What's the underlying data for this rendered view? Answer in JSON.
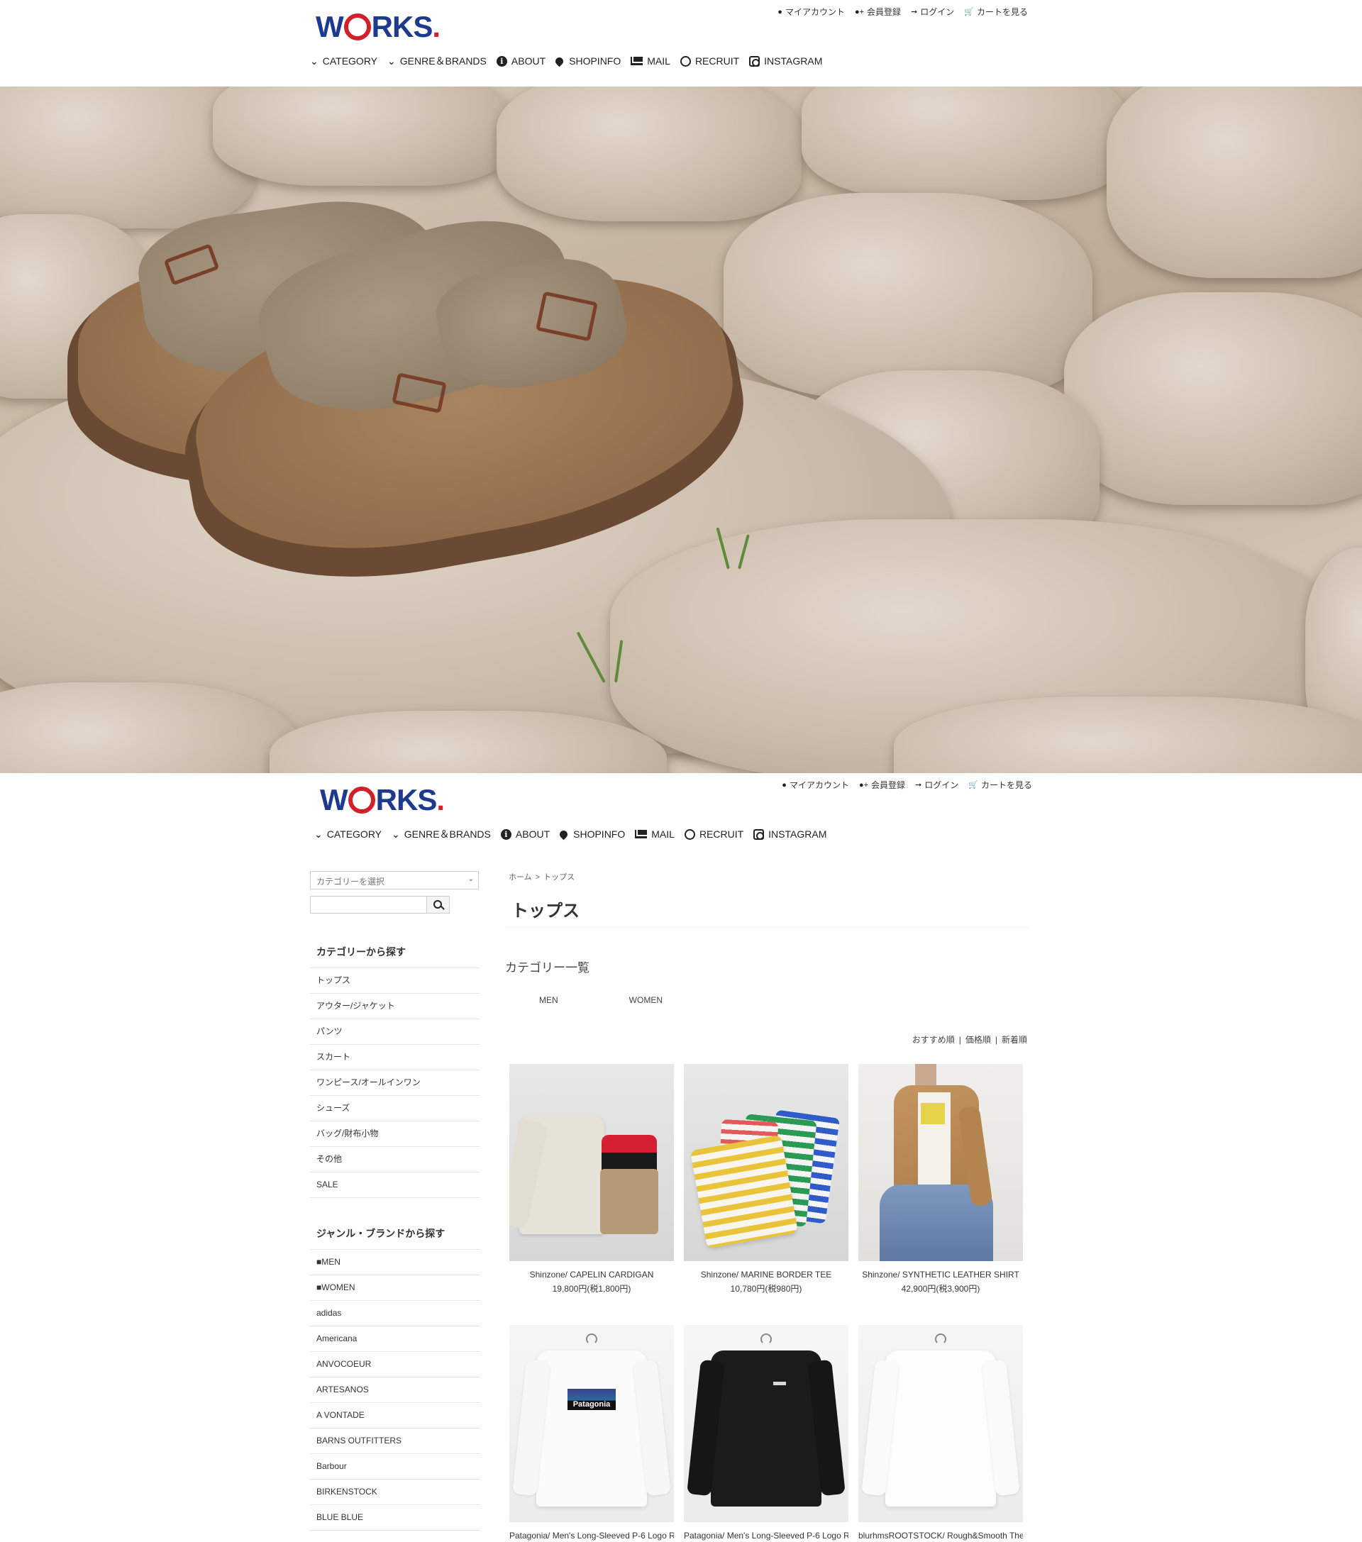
{
  "header": {
    "logo_main": "W",
    "logo_o": "",
    "logo_rest": "RKS",
    "logo_dot": ".",
    "util": [
      {
        "label": "マイアカウント",
        "icon": "user-icon"
      },
      {
        "label": "会員登録",
        "icon": "user-plus-icon"
      },
      {
        "label": "ログイン",
        "icon": "sign-in-icon"
      },
      {
        "label": "カートを見る",
        "icon": "cart-icon"
      }
    ],
    "nav": [
      {
        "label": "CATEGORY",
        "icon": "chevron-down-icon"
      },
      {
        "label": "GENRE＆BRANDS",
        "icon": "chevron-down-icon"
      },
      {
        "label": "ABOUT",
        "icon": "info-icon"
      },
      {
        "label": "SHOPINFO",
        "icon": "map-pin-icon"
      },
      {
        "label": "MAIL",
        "icon": "mail-icon"
      },
      {
        "label": "RECRUIT",
        "icon": "smile-icon"
      },
      {
        "label": "INSTAGRAM",
        "icon": "instagram-icon"
      }
    ]
  },
  "sidebar": {
    "select_placeholder": "カテゴリーを選択",
    "category_heading": "カテゴリーから探す",
    "categories": [
      "トップス",
      "アウター/ジャケット",
      "パンツ",
      "スカート",
      "ワンピース/オールインワン",
      "シューズ",
      "バッグ/財布小物",
      "その他",
      "SALE"
    ],
    "brand_heading": "ジャンル・ブランドから探す",
    "brands": [
      "■MEN",
      "■WOMEN",
      "adidas",
      "Americana",
      "ANVOCOEUR",
      "ARTESANOS",
      "A VONTADE",
      "BARNS OUTFITTERS",
      "Barbour",
      "BIRKENSTOCK",
      "BLUE BLUE"
    ]
  },
  "content": {
    "breadcrumb": [
      "ホーム",
      "トップス"
    ],
    "breadcrumb_sep": ">",
    "title": "トップス",
    "category_list_title": "カテゴリー一覧",
    "sub_categories": [
      "MEN",
      "WOMEN"
    ],
    "sort": [
      "おすすめ順",
      "価格順",
      "新着順"
    ],
    "sort_sep": "|",
    "products": [
      {
        "name": "Shinzone/ CAPELIN CARDIGAN",
        "price": "19,800円(税1,800円)"
      },
      {
        "name": "Shinzone/ MARINE BORDER TEE",
        "price": "10,780円(税980円)"
      },
      {
        "name": "Shinzone/ SYNTHETIC LEATHER SHIRT",
        "price": "42,900円(税3,900円)"
      },
      {
        "name": "Patagonia/ Men's Long-Sleeved P-6 Logo R",
        "price": ""
      },
      {
        "name": "Patagonia/ Men's Long-Sleeved P-6 Logo R",
        "price": ""
      },
      {
        "name": "blurhmsROOTSTOCK/ Rough&Smooth The",
        "price": ""
      }
    ],
    "patagonia_logo": "Patagonia"
  },
  "colors": {
    "brand_blue": "#1d3a8f",
    "brand_red": "#d0202a"
  }
}
